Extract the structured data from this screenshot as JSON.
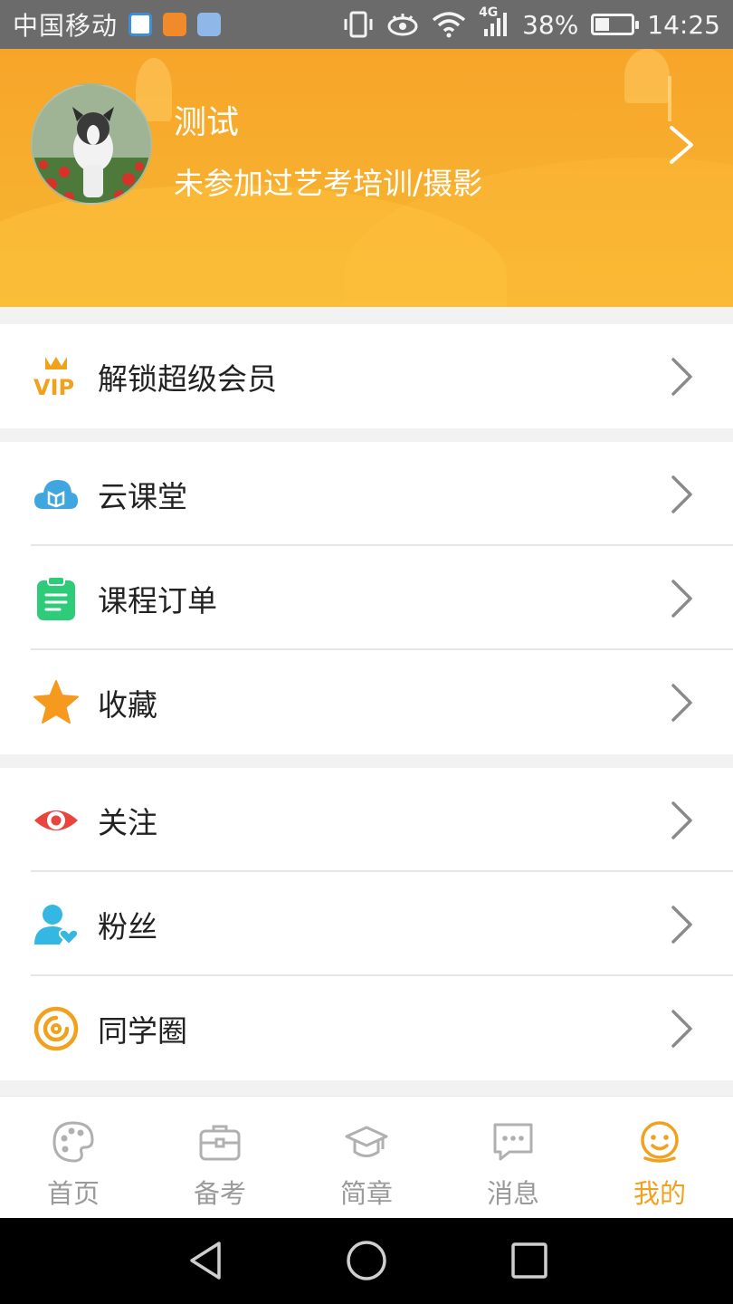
{
  "status_bar": {
    "carrier": "中国移动",
    "network": "4G",
    "battery": "38%",
    "battery_level": 0.38,
    "time": "14:25"
  },
  "profile": {
    "name": "测试",
    "description": "未参加过艺考培训/摄影"
  },
  "menu_groups": [
    [
      {
        "label": "解锁超级会员",
        "icon": "vip-icon",
        "color": "#f0a21f"
      }
    ],
    [
      {
        "label": "云课堂",
        "icon": "cloud-classroom-icon",
        "color": "#3fa6e0"
      },
      {
        "label": "课程订单",
        "icon": "course-order-icon",
        "color": "#2ecb78"
      },
      {
        "label": "收藏",
        "icon": "star-icon",
        "color": "#f59a1f"
      }
    ],
    [
      {
        "label": "关注",
        "icon": "eye-icon",
        "color": "#e9453f"
      },
      {
        "label": "粉丝",
        "icon": "fans-icon",
        "color": "#35b7e3"
      },
      {
        "label": "同学圈",
        "icon": "classmates-circle-icon",
        "color": "#f0a21f"
      }
    ]
  ],
  "bottom_nav": [
    {
      "label": "首页",
      "icon": "palette-icon",
      "active": false
    },
    {
      "label": "备考",
      "icon": "briefcase-icon",
      "active": false
    },
    {
      "label": "简章",
      "icon": "graduation-cap-icon",
      "active": false
    },
    {
      "label": "消息",
      "icon": "chat-icon",
      "active": false
    },
    {
      "label": "我的",
      "icon": "smiley-face-icon",
      "active": true
    }
  ],
  "colors": {
    "accent": "#f0a21f",
    "header": "#f7a52a",
    "inactive": "#9a9a9a"
  }
}
